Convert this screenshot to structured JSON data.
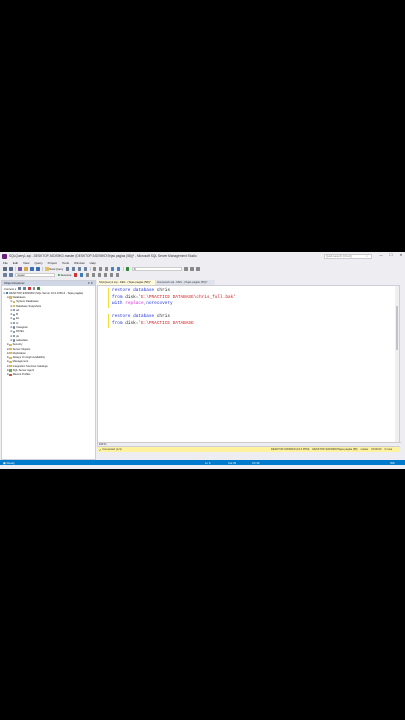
{
  "window": {
    "title": "SQLQuery1.sql - DESKTOP-9JDS9KD.master (DESKTOP-9JDS9KD\\Tejas paglas (58))* - Microsoft SQL Server Management Studio",
    "quick_launch_placeholder": "Quick Launch (Ctrl+Q)",
    "minimize": "—",
    "maximize": "☐",
    "close": "✕"
  },
  "menu": [
    "File",
    "Edit",
    "View",
    "Query",
    "Project",
    "Tools",
    "Window",
    "Help"
  ],
  "toolbar": {
    "new_query_label": "New Query",
    "database_combo": "master",
    "execute_label": "Execute",
    "search_combo": "hr"
  },
  "object_explorer": {
    "title": "Object Explorer",
    "pin": "▾ ✕",
    "connect_label": "Connect ▾",
    "tree": [
      {
        "depth": 0,
        "exp": "⊟",
        "icon": "server",
        "label": "DESKTOP-9JDS9KD (SQL Server 16.0.1050.6 - Tejas paglas)"
      },
      {
        "depth": 1,
        "exp": "⊟",
        "icon": "folder",
        "label": "Databases"
      },
      {
        "depth": 2,
        "exp": "⊞",
        "icon": "folder",
        "label": "System Databases"
      },
      {
        "depth": 2,
        "exp": "⊞",
        "icon": "folder",
        "label": "Database Snapshots"
      },
      {
        "depth": 2,
        "exp": "⊞",
        "icon": "db",
        "label": "ad"
      },
      {
        "depth": 2,
        "exp": "⊞",
        "icon": "db",
        "label": "B"
      },
      {
        "depth": 2,
        "exp": "⊞",
        "icon": "db",
        "label": "Ec"
      },
      {
        "depth": 2,
        "exp": "⊞",
        "icon": "db",
        "label": "hr"
      },
      {
        "depth": 2,
        "exp": "⊞",
        "icon": "db",
        "label": "Instagram"
      },
      {
        "depth": 2,
        "exp": "⊞",
        "icon": "db",
        "label": "PATEL"
      },
      {
        "depth": 2,
        "exp": "⊞",
        "icon": "db",
        "label": "pk"
      },
      {
        "depth": 2,
        "exp": "⊞",
        "icon": "db",
        "label": "salesdata"
      },
      {
        "depth": 1,
        "exp": "⊞",
        "icon": "folder",
        "label": "Security"
      },
      {
        "depth": 1,
        "exp": "⊞",
        "icon": "folder",
        "label": "Server Objects"
      },
      {
        "depth": 1,
        "exp": "⊞",
        "icon": "folder",
        "label": "Replication"
      },
      {
        "depth": 1,
        "exp": "⊞",
        "icon": "folder",
        "label": "Always On High Availability"
      },
      {
        "depth": 1,
        "exp": "⊞",
        "icon": "folder",
        "label": "Management"
      },
      {
        "depth": 1,
        "exp": "⊞",
        "icon": "folder",
        "label": "Integration Services Catalogs"
      },
      {
        "depth": 1,
        "exp": "⊞",
        "icon": "agent",
        "label": "SQL Server Agent"
      },
      {
        "depth": 1,
        "exp": "⊞",
        "icon": "profiler",
        "label": "XEvent Profiler"
      }
    ]
  },
  "tabs": [
    {
      "label": "SQLQuery1.sql - DES...(Tejas paglas (58))*",
      "active": true
    },
    {
      "label": "Homework.sql - DES...(Tejas paglas (56))*",
      "active": false
    }
  ],
  "editor": {
    "lines": [
      [
        [
          "kw",
          "restore database "
        ],
        [
          "plain",
          "chris"
        ]
      ],
      [
        [
          "kw",
          "from "
        ],
        [
          "plain",
          "disk"
        ],
        [
          "gray",
          "="
        ],
        [
          "str",
          "'E:\\PRACTICE DATABASE\\chris_full.bak'"
        ]
      ],
      [
        [
          "kw",
          "with "
        ],
        [
          "pink",
          "replace"
        ],
        [
          "gray",
          ","
        ],
        [
          "kw",
          "norecovery"
        ]
      ],
      [
        [
          "plain",
          ""
        ]
      ],
      [
        [
          "kw",
          "restore database "
        ],
        [
          "plain",
          "chris"
        ]
      ],
      [
        [
          "kw",
          "from "
        ],
        [
          "plain",
          "disk"
        ],
        [
          "gray",
          "="
        ],
        [
          "str",
          "'E:\\PRACTICE DATABASE"
        ]
      ]
    ],
    "zoom": "100 %"
  },
  "query_status": {
    "connected": "Connected. (1/1)",
    "server": "DESKTOP-9JDS9KD (16.0 RTM)",
    "user": "DESKTOP-9JDS9KD\\Tejas paglas (58)",
    "database": "master",
    "elapsed": "00:00:00",
    "rows": "0 rows"
  },
  "statusbar": {
    "ready": "Ready",
    "ln": "Ln 6",
    "col": "Col 33",
    "ch": "Ch 33",
    "mode": "INS"
  },
  "colors": {
    "accent": "#007acc",
    "query_status": "#fff29e",
    "keyword": "#1f2fd8",
    "string": "#d11b1b"
  }
}
